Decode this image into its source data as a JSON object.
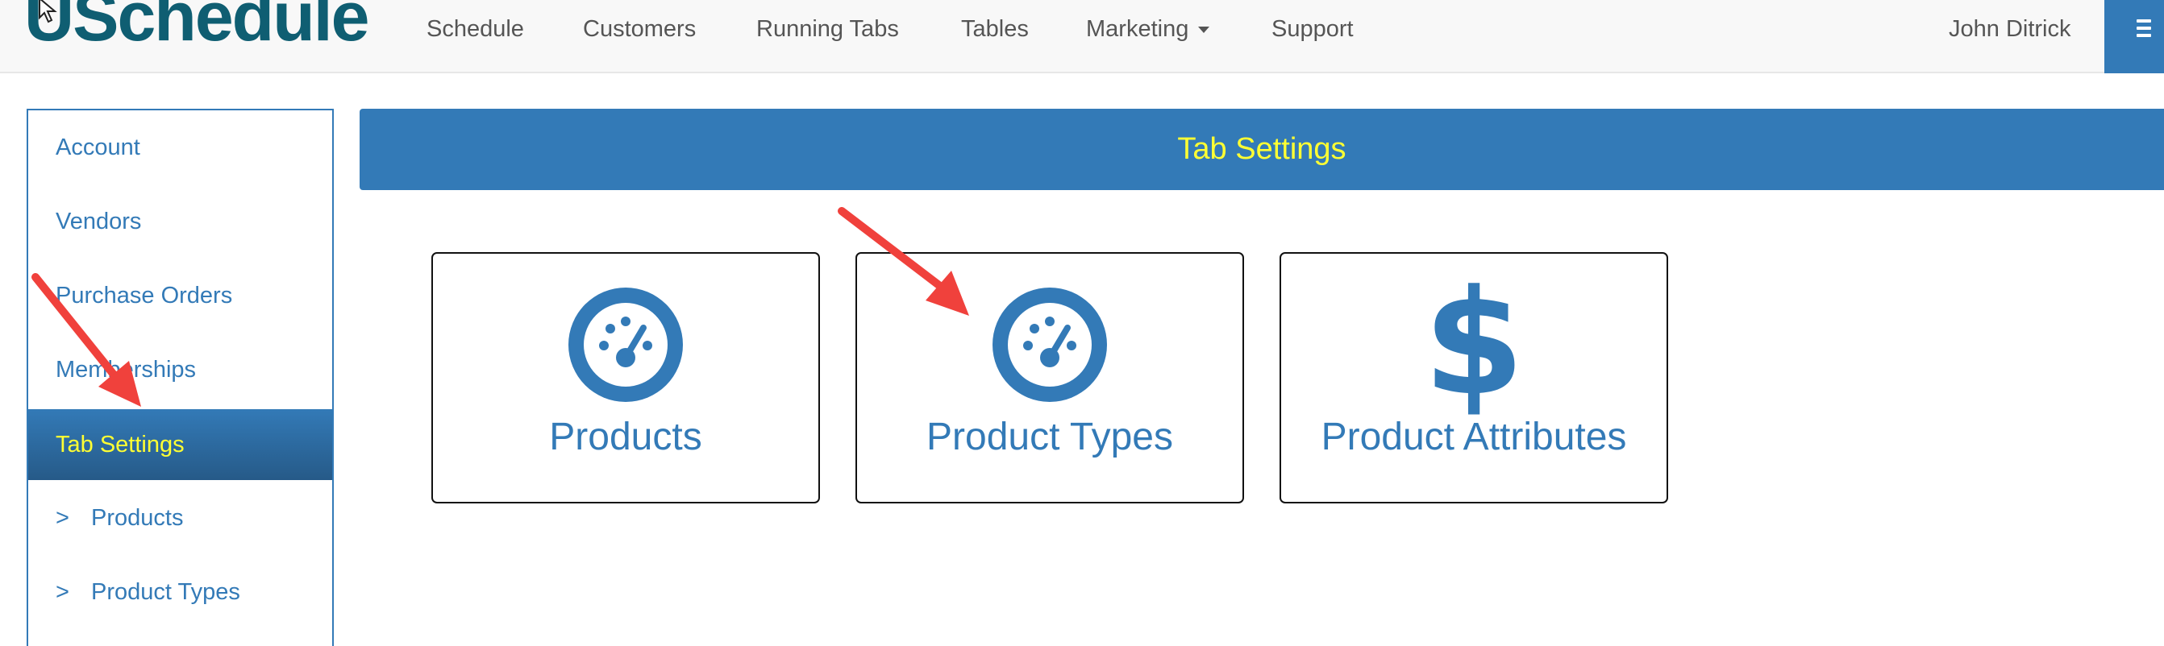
{
  "navbar": {
    "logo": "USchedule",
    "items": [
      {
        "label": "Schedule"
      },
      {
        "label": "Customers"
      },
      {
        "label": "Running Tabs"
      },
      {
        "label": "Tables"
      },
      {
        "label": "Marketing"
      },
      {
        "label": "Support"
      }
    ],
    "user": "John Ditrick",
    "menu_icon": "hamburger-icon"
  },
  "sidebar": {
    "items": [
      {
        "label": "Account",
        "prefix": ""
      },
      {
        "label": "Vendors",
        "prefix": ""
      },
      {
        "label": "Purchase Orders",
        "prefix": ""
      },
      {
        "label": "Memberships",
        "prefix": ""
      },
      {
        "label": "Tab Settings",
        "prefix": "",
        "active": true
      },
      {
        "label": "Products",
        "prefix": ">"
      },
      {
        "label": "Product Types",
        "prefix": ">"
      }
    ]
  },
  "main": {
    "title": "Tab Settings",
    "tiles": [
      {
        "label": "Products",
        "icon": "dashboard-icon"
      },
      {
        "label": "Product Types",
        "icon": "dashboard-icon"
      },
      {
        "label": "Product Attributes",
        "icon": "dollar-icon",
        "glyph": "$"
      }
    ]
  },
  "colors": {
    "brand": "#0f5e72",
    "primary": "#337ab7",
    "highlight": "#ffff33",
    "annotation": "#f0413c"
  }
}
